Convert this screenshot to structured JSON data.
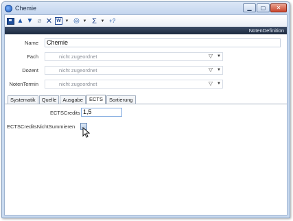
{
  "window": {
    "title": "Chemie",
    "controls": [
      "minimize",
      "maximize",
      "close"
    ]
  },
  "toolbar": {
    "items": [
      {
        "icon": "save-icon"
      },
      {
        "icon": "arrow-up-icon"
      },
      {
        "icon": "arrow-down-icon"
      },
      {
        "icon": "paperclip-icon"
      },
      {
        "icon": "delete-icon"
      },
      {
        "icon": "word-icon"
      },
      {
        "icon": "clock-icon"
      },
      {
        "icon": "sigma-icon"
      },
      {
        "icon": "help-icon"
      }
    ]
  },
  "header": {
    "text": "NotenDefinition"
  },
  "form": {
    "name": {
      "label": "Name",
      "value": "Chemie"
    },
    "fach": {
      "label": "Fach",
      "placeholder": "nicht zugeordnet"
    },
    "dozent": {
      "label": "Dozent",
      "placeholder": "nicht zugeordnet"
    },
    "notentermin": {
      "label": "NotenTermin",
      "placeholder": "nicht zugeordnet"
    }
  },
  "tabs": [
    {
      "label": "Systematik",
      "active": false
    },
    {
      "label": "Quelle",
      "active": false
    },
    {
      "label": "Ausgabe",
      "active": false
    },
    {
      "label": "ECTS",
      "active": true
    },
    {
      "label": "Sortierung",
      "active": false
    }
  ],
  "ects": {
    "credits_label": "ECTSCredits",
    "credits_value": "1,5",
    "not_sum_label": "ECTSCreditsNichtSummieren",
    "not_sum_checked": false
  }
}
